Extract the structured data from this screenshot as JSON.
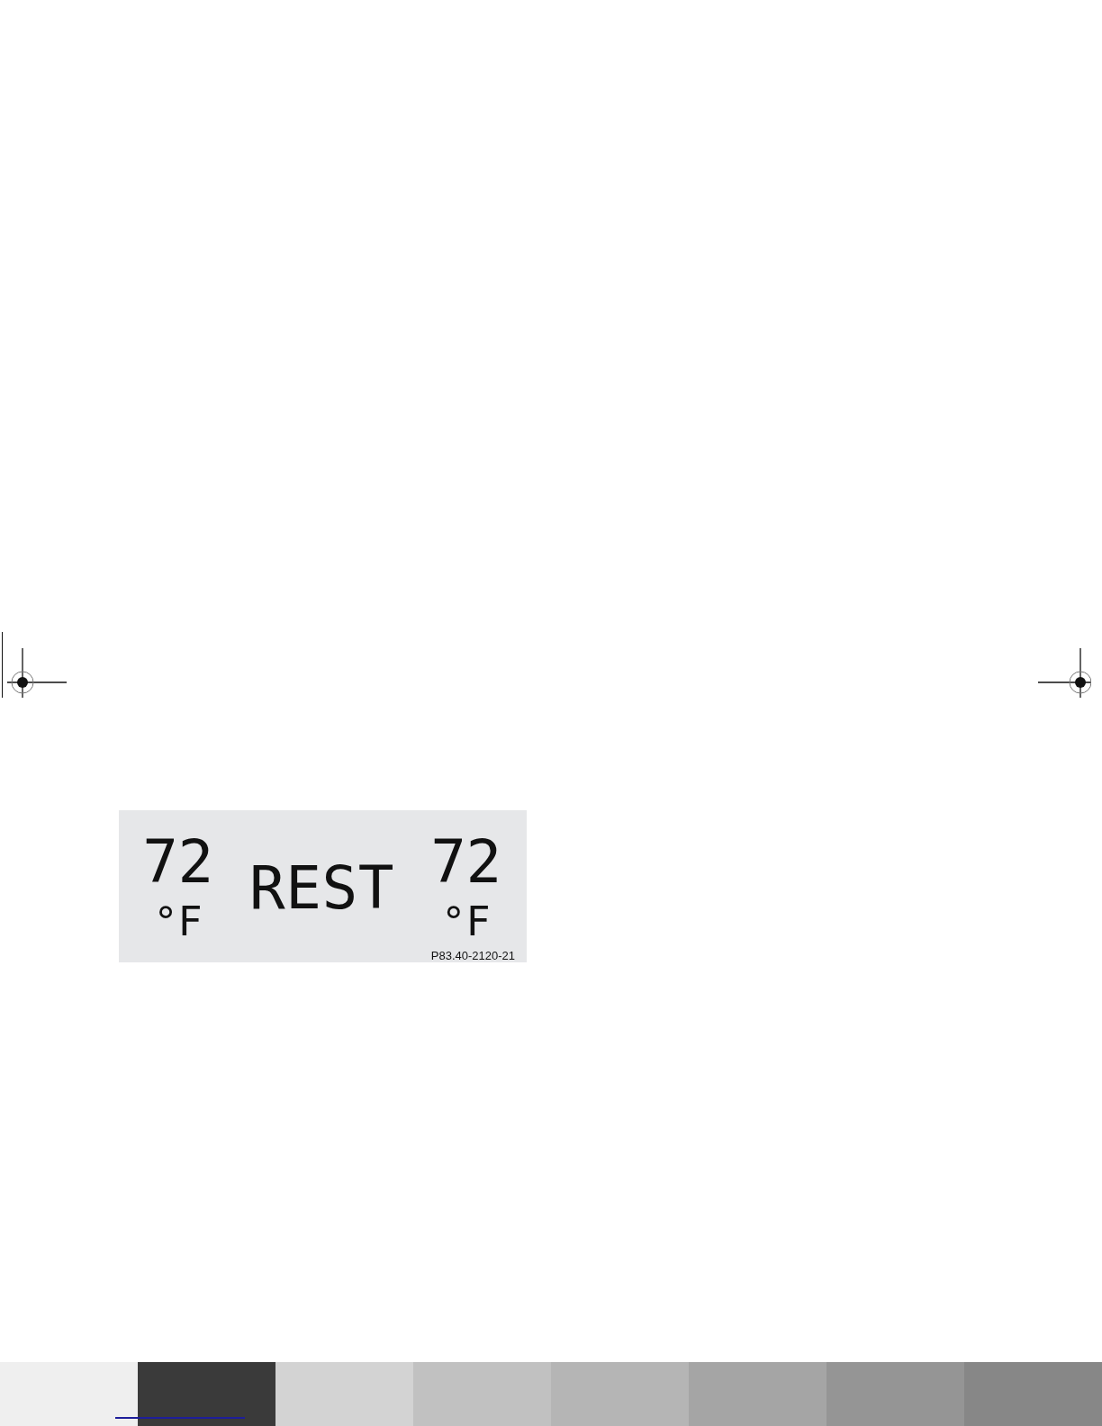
{
  "display": {
    "left_zone": {
      "temperature": "72",
      "unit": "°F"
    },
    "mode": "REST",
    "right_zone": {
      "temperature": "72",
      "unit": "°F"
    },
    "figure_code": "P83.40-2120-21"
  },
  "control_strip": [
    {
      "color": "#efefef"
    },
    {
      "color": "#3a3a3a"
    },
    {
      "color": "#d3d3d3"
    },
    {
      "color": "#c1c1c1"
    },
    {
      "color": "#b5b5b5"
    },
    {
      "color": "#a5a5a5"
    },
    {
      "color": "#959595"
    },
    {
      "color": "#878787"
    }
  ]
}
